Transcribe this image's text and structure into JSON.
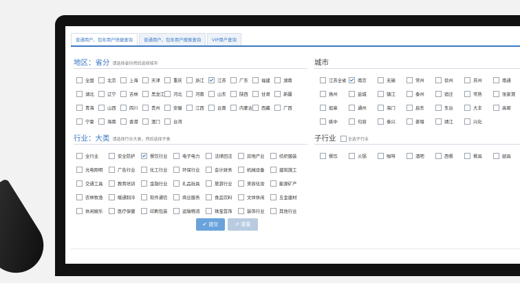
{
  "tabs": [
    "普通用户、包年用户快捷查询",
    "普通用户、包年用户搜索查询",
    "VIP用户查询"
  ],
  "region": {
    "title": "地区：省分",
    "hint": "请选择省份然后选择城市",
    "options": [
      {
        "label": "全国",
        "checked": false
      },
      {
        "label": "北京",
        "checked": false
      },
      {
        "label": "上海",
        "checked": false
      },
      {
        "label": "天津",
        "checked": false
      },
      {
        "label": "重庆",
        "checked": false
      },
      {
        "label": "浙江",
        "checked": false
      },
      {
        "label": "江苏",
        "checked": true
      },
      {
        "label": "广东",
        "checked": false
      },
      {
        "label": "福建",
        "checked": false
      },
      {
        "label": "湖南",
        "checked": false
      },
      {
        "label": "湖北",
        "checked": false
      },
      {
        "label": "辽宁",
        "checked": false
      },
      {
        "label": "吉林",
        "checked": false
      },
      {
        "label": "黑龙江",
        "checked": false
      },
      {
        "label": "河北",
        "checked": false
      },
      {
        "label": "河南",
        "checked": false
      },
      {
        "label": "山东",
        "checked": false
      },
      {
        "label": "陕西",
        "checked": false
      },
      {
        "label": "甘肃",
        "checked": false
      },
      {
        "label": "新疆",
        "checked": false
      },
      {
        "label": "青海",
        "checked": false
      },
      {
        "label": "山西",
        "checked": false
      },
      {
        "label": "四川",
        "checked": false
      },
      {
        "label": "贵州",
        "checked": false
      },
      {
        "label": "安徽",
        "checked": false
      },
      {
        "label": "江西",
        "checked": false
      },
      {
        "label": "云南",
        "checked": false
      },
      {
        "label": "内蒙古",
        "checked": false
      },
      {
        "label": "西藏",
        "checked": false
      },
      {
        "label": "广西",
        "checked": false
      },
      {
        "label": "宁夏",
        "checked": false
      },
      {
        "label": "海南",
        "checked": false
      },
      {
        "label": "香港",
        "checked": false
      },
      {
        "label": "澳门",
        "checked": false
      },
      {
        "label": "台湾",
        "checked": false
      }
    ]
  },
  "city": {
    "title": "城市",
    "options": [
      {
        "label": "江苏全省",
        "checked": false
      },
      {
        "label": "南京",
        "checked": true
      },
      {
        "label": "无锡",
        "checked": false
      },
      {
        "label": "常州",
        "checked": false
      },
      {
        "label": "徐州",
        "checked": false
      },
      {
        "label": "苏州",
        "checked": false
      },
      {
        "label": "南通",
        "checked": false
      },
      {
        "label": "扬州",
        "checked": false
      },
      {
        "label": "盐城",
        "checked": false
      },
      {
        "label": "镇江",
        "checked": false
      },
      {
        "label": "泰州",
        "checked": false
      },
      {
        "label": "宿迁",
        "checked": false
      },
      {
        "label": "常熟",
        "checked": false
      },
      {
        "label": "张家港",
        "checked": false
      },
      {
        "label": "如皋",
        "checked": false
      },
      {
        "label": "通州",
        "checked": false
      },
      {
        "label": "海门",
        "checked": false
      },
      {
        "label": "启东",
        "checked": false
      },
      {
        "label": "东台",
        "checked": false
      },
      {
        "label": "大丰",
        "checked": false
      },
      {
        "label": "高邮",
        "checked": false
      },
      {
        "label": "姚中",
        "checked": false
      },
      {
        "label": "句容",
        "checked": false
      },
      {
        "label": "泰兴",
        "checked": false
      },
      {
        "label": "姜堰",
        "checked": false
      },
      {
        "label": "靖江",
        "checked": false
      },
      {
        "label": "兴化",
        "checked": false
      }
    ]
  },
  "industry": {
    "title": "行业：大类",
    "hint": "请选择行业大类，然后选择子类",
    "options": [
      {
        "label": "全行业",
        "checked": false
      },
      {
        "label": "安全防护",
        "checked": false
      },
      {
        "label": "餐饮行业",
        "checked": true
      },
      {
        "label": "电子电力",
        "checked": false
      },
      {
        "label": "法律回法",
        "checked": false
      },
      {
        "label": "房地产业",
        "checked": false
      },
      {
        "label": "纺织服装",
        "checked": false
      },
      {
        "label": "光电照明",
        "checked": false
      },
      {
        "label": "广告行业",
        "checked": false
      },
      {
        "label": "化工行业",
        "checked": false
      },
      {
        "label": "环保行业",
        "checked": false
      },
      {
        "label": "会计财务",
        "checked": false
      },
      {
        "label": "机械设备",
        "checked": false
      },
      {
        "label": "建筑施工",
        "checked": false
      },
      {
        "label": "交通工具",
        "checked": false
      },
      {
        "label": "教育培训",
        "checked": false
      },
      {
        "label": "金融行业",
        "checked": false
      },
      {
        "label": "礼品玩具",
        "checked": false
      },
      {
        "label": "旅游行业",
        "checked": false
      },
      {
        "label": "美容化妆",
        "checked": false
      },
      {
        "label": "能源矿产",
        "checked": false
      },
      {
        "label": "农林牧渔",
        "checked": false
      },
      {
        "label": "暖通制冷",
        "checked": false
      },
      {
        "label": "软件通信",
        "checked": false
      },
      {
        "label": "商业服务",
        "checked": false
      },
      {
        "label": "食品饮料",
        "checked": false
      },
      {
        "label": "文体休闲",
        "checked": false
      },
      {
        "label": "五金建材",
        "checked": false
      },
      {
        "label": "休闲娱乐",
        "checked": false
      },
      {
        "label": "医疗保健",
        "checked": false
      },
      {
        "label": "印刷包装",
        "checked": false
      },
      {
        "label": "运输物流",
        "checked": false
      },
      {
        "label": "珠宝首饰",
        "checked": false
      },
      {
        "label": "装饰行业",
        "checked": false
      },
      {
        "label": "其他行业",
        "checked": false
      }
    ]
  },
  "subindustry": {
    "title": "子行业",
    "hint": "全选子行业",
    "options": [
      {
        "label": "餐饮",
        "checked": false
      },
      {
        "label": "火锅",
        "checked": false
      },
      {
        "label": "咖啡",
        "checked": false
      },
      {
        "label": "酒吧",
        "checked": false
      },
      {
        "label": "西餐",
        "checked": false
      },
      {
        "label": "餐具",
        "checked": false
      },
      {
        "label": "厨具",
        "checked": false
      }
    ]
  },
  "buttons": {
    "submit": "提交",
    "reset": "重置"
  },
  "colors": {
    "accent": "#3a78c3",
    "submit": "#6aa3dc",
    "reset": "#b8cbe0"
  }
}
